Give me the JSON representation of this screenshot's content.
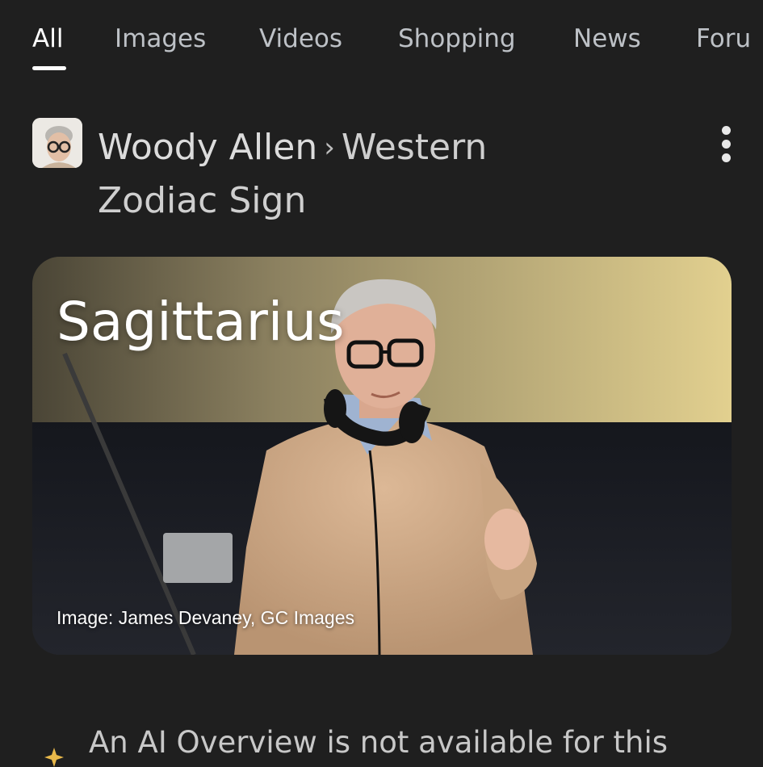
{
  "tabs": [
    {
      "label": "All",
      "active": true
    },
    {
      "label": "Images"
    },
    {
      "label": "Videos"
    },
    {
      "label": "Shopping"
    },
    {
      "label": "News"
    },
    {
      "label": "Foru"
    }
  ],
  "result": {
    "breadcrumb_primary": "Woody Allen",
    "breadcrumb_separator": "›",
    "breadcrumb_secondary_line1": "Western",
    "breadcrumb_secondary_line2": "Zodiac Sign",
    "thumbnail_icon": "person-thumbnail"
  },
  "card": {
    "title": "Sagittarius",
    "image_credit": "Image: James Devaney, GC Images"
  },
  "ai_overview": {
    "text": "An AI Overview is not available for this",
    "icon": "sparkle-icon",
    "icon_color": "#e8b84a"
  },
  "colors": {
    "background": "#1f1f1f",
    "active_tab": "#ffffff",
    "inactive_tab": "#bdc1c6"
  }
}
